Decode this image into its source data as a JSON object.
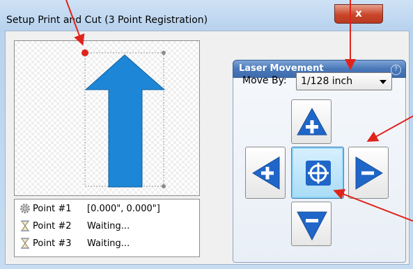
{
  "window": {
    "title": "Setup Print and Cut (3 Point Registration)",
    "close_label": "x"
  },
  "preview": {
    "selected_point": 1
  },
  "points": [
    {
      "name": "Point #1",
      "status": "[0.000\", 0.000\"]",
      "icon": "gear-icon"
    },
    {
      "name": "Point #2",
      "status": "Waiting...",
      "icon": "hourglass-icon"
    },
    {
      "name": "Point #3",
      "status": "Waiting...",
      "icon": "hourglass-icon"
    }
  ],
  "laser_movement": {
    "title": "Laser Movement",
    "move_by_label": "Move By:",
    "move_by_value": "1/128 inch",
    "buttons": [
      "move-up",
      "move-left",
      "center",
      "move-right",
      "move-down"
    ]
  },
  "colors": {
    "accent_blue": "#1e86d6",
    "annotation_red": "#e0241b",
    "header_blue": "#4a78b8"
  }
}
